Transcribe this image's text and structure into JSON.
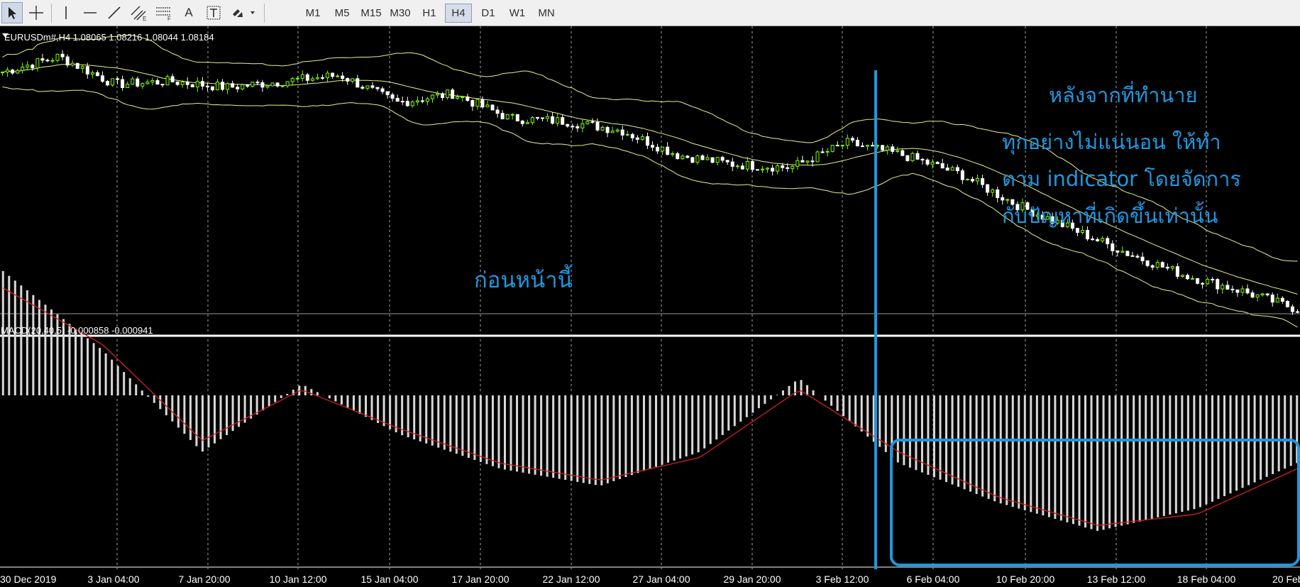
{
  "toolbar": {
    "tools": [
      {
        "name": "cursor-tool",
        "icon": "arrow-icon"
      },
      {
        "name": "crosshair-tool",
        "icon": "crosshair-icon"
      },
      {
        "name": "vertical-line-tool",
        "icon": "vertical-line-icon"
      },
      {
        "name": "horizontal-line-tool",
        "icon": "horizontal-line-icon"
      },
      {
        "name": "trendline-tool",
        "icon": "trendline-icon"
      },
      {
        "name": "equidistant-channel-tool",
        "icon": "channel-icon"
      },
      {
        "name": "fibonacci-tool",
        "icon": "fibonacci-icon"
      },
      {
        "name": "text-tool",
        "icon": "text-icon"
      },
      {
        "name": "text-label-tool",
        "icon": "text-label-icon"
      },
      {
        "name": "arrows-tool",
        "icon": "arrows-icon"
      }
    ],
    "text_tool_glyph": "A",
    "timeframes": [
      "M1",
      "M5",
      "M15",
      "M30",
      "H1",
      "H4",
      "D1",
      "W1",
      "MN"
    ],
    "active_timeframe": "H4"
  },
  "chart_header": {
    "symbol_line": "EURUSDm#,H4  1.08065 1.08216 1.08044 1.08184"
  },
  "macd_header": {
    "text": "MACD(20,40,5) -0.000858 -0.000941"
  },
  "x_axis": {
    "labels": [
      "30 Dec 2019",
      "3 Jan 04:00",
      "7 Jan 20:00",
      "10 Jan 12:00",
      "15 Jan 04:00",
      "17 Jan 20:00",
      "22 Jan 12:00",
      "27 Jan 04:00",
      "29 Jan 20:00",
      "3 Feb 12:00",
      "6 Feb 04:00",
      "10 Feb 20:00",
      "13 Feb 12:00",
      "18 Feb 04:00",
      "20 Feb"
    ]
  },
  "annotations": {
    "before": "ก่อนหน้านี้",
    "after_title": "หลังจากที่ทำนาย",
    "after_line1": "ทุกอย่างไม่แน่นอน ให้ทำ",
    "after_line2": "ตาม indicator โดยจัดการ",
    "after_line3": "กับปัญหาที่เกิดขึ้นเท่านั้น"
  },
  "colors": {
    "background": "#000000",
    "bullish_candle": "#7cfc00",
    "bearish_candle": "#ffffff",
    "bollinger": "#e8f08c",
    "macd_hist": "#d8d8d8",
    "macd_signal": "#d02020",
    "annotation": "#1e98e0",
    "grid": "#c8c8c8"
  },
  "chart_data": {
    "type": "line",
    "symbol": "EURUSDm#",
    "timeframe": "H4",
    "ohlc_last": {
      "open": 1.08065,
      "high": 1.08216,
      "low": 1.08044,
      "close": 1.08184
    },
    "x_labels": [
      "30 Dec 2019",
      "3 Jan 04:00",
      "7 Jan 20:00",
      "10 Jan 12:00",
      "15 Jan 04:00",
      "17 Jan 20:00",
      "22 Jan 12:00",
      "27 Jan 04:00",
      "29 Jan 20:00",
      "3 Feb 12:00",
      "6 Feb 04:00",
      "10 Feb 20:00",
      "13 Feb 12:00",
      "18 Feb 04:00",
      "20 Feb"
    ],
    "price_path": [
      1.1175,
      1.12,
      1.1155,
      1.116,
      1.115,
      1.116,
      1.117,
      1.1125,
      1.114,
      1.11,
      1.1095,
      1.108,
      1.104,
      1.1025,
      1.102,
      1.106,
      1.104,
      1.101,
      1.096,
      1.092,
      1.088,
      1.0845,
      1.082,
      1.079
    ],
    "price_range": [
      1.077,
      1.124
    ],
    "series": [
      {
        "name": "MACD(20,40,5)",
        "values": [
          0.0022,
          0.0008,
          -0.001,
          0.0002,
          -0.0007,
          -0.0013,
          -0.0016,
          -0.001,
          0.0003,
          -0.0012,
          -0.0019,
          -0.0024,
          -0.002,
          -0.0012
        ]
      },
      {
        "values": [
          0.0019,
          0.0009,
          -0.0008,
          0.0001,
          -0.0006,
          -0.0012,
          -0.0015,
          -0.0011,
          0.0001,
          -0.001,
          -0.0018,
          -0.0023,
          -0.0021,
          -0.0013
        ]
      }
    ],
    "macd_last": {
      "main": -0.000858,
      "signal": -0.000941
    },
    "grid": true
  }
}
